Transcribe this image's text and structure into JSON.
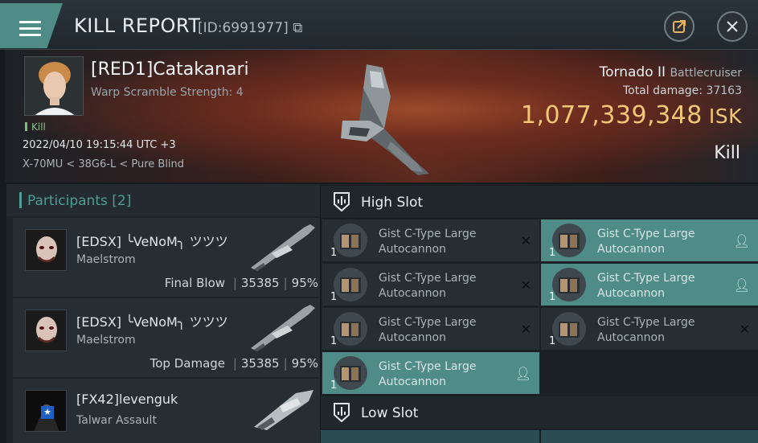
{
  "topbar": {
    "title": "KILL REPORT",
    "report_id": "[ID:6991977]",
    "menu_icon": "hamburger-icon",
    "share_icon": "share-external-icon",
    "close_icon": "close-icon"
  },
  "victim": {
    "name": "[RED1]Catakanari",
    "subtitle": "Warp Scramble Strength: 4",
    "result_tag": "Kill",
    "datetime": "2022/04/10 19:15:44 UTC +3",
    "location": "X-70MU < 38G6-L < Pure Blind",
    "ship_name": "Tornado II",
    "ship_class": "Battlecruiser",
    "total_damage_label": "Total damage:",
    "total_damage_value": "37163",
    "isk_value": "1,077,339,348",
    "isk_unit": "ISK",
    "outcome": "Kill"
  },
  "participants": {
    "title": "Participants [2]",
    "rows": [
      {
        "name": "[EDSX] ╰VeNoM╮ ツツツ",
        "ship": "Maelstrom",
        "stat_label": "Final Blow",
        "damage": "35385",
        "percent": "95%"
      },
      {
        "name": "[EDSX] ╰VeNoM╮ ツツツ",
        "ship": "Maelstrom",
        "stat_label": "Top Damage",
        "damage": "35385",
        "percent": "95%"
      },
      {
        "name": "[FX42]levenguk",
        "ship": "Talwar Assault",
        "stat_label": "",
        "damage": "",
        "percent": ""
      }
    ]
  },
  "slots": {
    "high": {
      "title": "High Slot",
      "modules": [
        {
          "name": "Gist C-Type Large Autocannon",
          "qty": "1",
          "status": "destroyed",
          "status_icon": "x-icon"
        },
        {
          "name": "Gist C-Type Large Autocannon",
          "qty": "1",
          "status": "dropped",
          "status_icon": "person-icon"
        },
        {
          "name": "Gist C-Type Large Autocannon",
          "qty": "1",
          "status": "destroyed",
          "status_icon": "x-icon"
        },
        {
          "name": "Gist C-Type Large Autocannon",
          "qty": "1",
          "status": "dropped",
          "status_icon": "person-icon"
        },
        {
          "name": "Gist C-Type Large Autocannon",
          "qty": "1",
          "status": "destroyed",
          "status_icon": "x-icon"
        },
        {
          "name": "Gist C-Type Large Autocannon",
          "qty": "1",
          "status": "destroyed",
          "status_icon": "x-icon"
        },
        {
          "name": "Gist C-Type Large Autocannon",
          "qty": "1",
          "status": "dropped",
          "status_icon": "person-icon"
        }
      ]
    },
    "low": {
      "title": "Low Slot"
    }
  },
  "colors": {
    "accent": "#4f8c88",
    "isk": "#f2c777",
    "kill_tag": "#7cbf74"
  }
}
